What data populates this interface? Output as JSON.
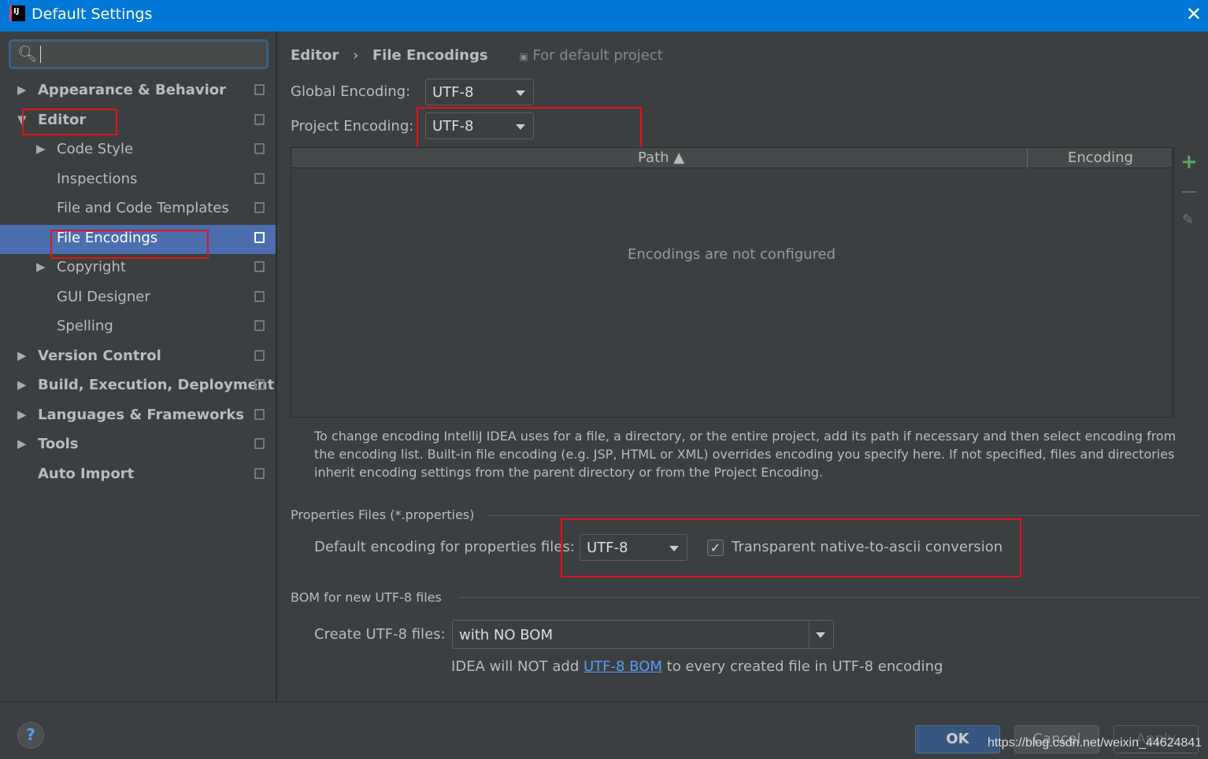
{
  "window": {
    "title": "Default Settings",
    "logo": "IJ"
  },
  "sidebar": {
    "search_placeholder": "",
    "items": [
      {
        "label": "Appearance & Behavior",
        "bold": true,
        "arrow": "▶",
        "level": 0
      },
      {
        "label": "Editor",
        "bold": true,
        "arrow": "▼",
        "level": 0
      },
      {
        "label": "Code Style",
        "arrow": "▶",
        "level": 1
      },
      {
        "label": "Inspections",
        "level": 1
      },
      {
        "label": "File and Code Templates",
        "level": 1
      },
      {
        "label": "File Encodings",
        "level": 1,
        "selected": true
      },
      {
        "label": "Copyright",
        "arrow": "▶",
        "level": 1
      },
      {
        "label": "GUI Designer",
        "level": 1
      },
      {
        "label": "Spelling",
        "level": 1
      },
      {
        "label": "Version Control",
        "bold": true,
        "arrow": "▶",
        "level": 0
      },
      {
        "label": "Build, Execution, Deployment",
        "bold": true,
        "arrow": "▶",
        "level": 0
      },
      {
        "label": "Languages & Frameworks",
        "bold": true,
        "arrow": "▶",
        "level": 0
      },
      {
        "label": "Tools",
        "bold": true,
        "arrow": "▶",
        "level": 0
      },
      {
        "label": "Auto Import",
        "bold": true,
        "level": 0
      }
    ]
  },
  "breadcrumb": {
    "parent": "Editor",
    "sep": "›",
    "current": "File Encodings",
    "scope": "For default project"
  },
  "global_encoding": {
    "label": "Global Encoding:",
    "value": "UTF-8"
  },
  "project_encoding": {
    "label": "Project Encoding:",
    "value": "UTF-8"
  },
  "table": {
    "columns": [
      "Path ▲",
      "Encoding"
    ],
    "empty_text": "Encodings are not configured"
  },
  "hint": "To change encoding IntelliJ IDEA uses for a file, a directory, or the entire project, add its path if necessary and then select encoding from the encoding list. Built-in file encoding (e.g. JSP, HTML or XML) overrides encoding you specify here. If not specified, files and directories inherit encoding settings from the parent directory or from the Project Encoding.",
  "properties": {
    "section": "Properties Files (*.properties)",
    "label": "Default encoding for properties files:",
    "value": "UTF-8",
    "checkbox_label": "Transparent native-to-ascii conversion",
    "checked": true
  },
  "bom": {
    "section": "BOM for new UTF-8 files",
    "label": "Create UTF-8 files:",
    "value": "with NO BOM",
    "note_before": "IDEA will NOT add ",
    "note_link": "UTF-8 BOM",
    "note_after": " to every created file in UTF-8 encoding"
  },
  "footer": {
    "help": "?",
    "ok": "OK",
    "cancel": "Cancel",
    "apply": "Apply",
    "watermark": "https://blog.csdn.net/weixin_44624841"
  },
  "colors": {
    "titlebar": "#0078d7",
    "selection": "#4b6eaf",
    "highlight_box": "#e0141e",
    "add": "#59a869",
    "link": "#589df6"
  }
}
